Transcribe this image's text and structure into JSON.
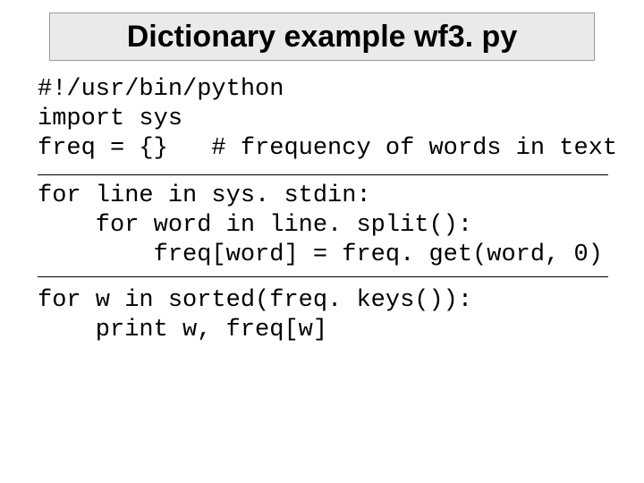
{
  "title": "Dictionary example wf3. py",
  "code": {
    "block1": "#!/usr/bin/python\nimport sys\nfreq = {}   # frequency of words in text",
    "block2": "for line in sys. stdin:\n    for word in line. split():\n        freq[word] = freq. get(word, 0)",
    "block3": "for w in sorted(freq. keys()):\n    print w, freq[w]"
  }
}
